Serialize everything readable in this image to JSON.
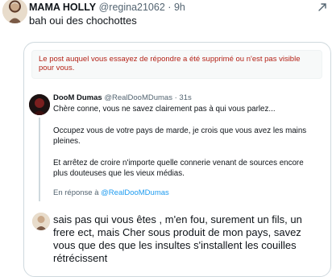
{
  "post": {
    "author_name": "MAMA HOLLY",
    "author_handle": "@regina21062",
    "separator": "·",
    "time": "9h",
    "text": "bah oui des chochottes"
  },
  "notice": {
    "text": "Le post auquel vous essayez de répondre a été supprimé ou n'est pas visible pour vous."
  },
  "quoted": {
    "author_name": "DooM Dumas",
    "author_handle": "@RealDooMDumas",
    "separator": "·",
    "time": "31s",
    "line1": "Chère conne, vous ne savez clairement pas à qui vous parlez...",
    "line2": "Occupez vous de votre pays de marde, je crois que vous avez les mains pleines.",
    "line3": "Et arrêtez de croire n'importe quelle connerie venant de sources encore plus douteuses que les vieux médias.",
    "in_reply_label": "En réponse à",
    "in_reply_handle": "@RealDooMDumas"
  },
  "reply": {
    "text": "sais pas qui vous êtes , m'en fou, surement un fils, un frere ect, mais Cher sous produit de mon pays, savez vous que des que les insultes s'installent les couilles rétrécissent"
  },
  "icons": {
    "share": "share-icon"
  }
}
